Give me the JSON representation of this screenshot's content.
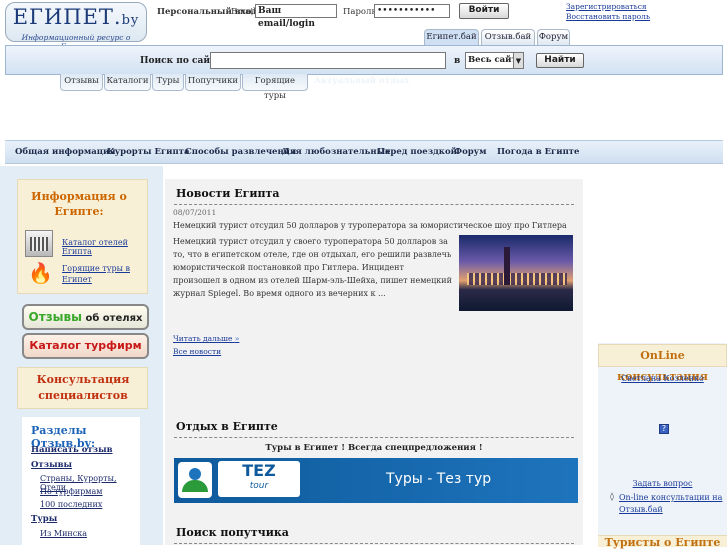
{
  "header": {
    "logo_title": "ЕГИПЕТ.",
    "logo_suffix": "by",
    "logo_subtitle": "Информационный ресурс о Египте",
    "login_label": "Персональный вход:",
    "email_label": "Email:",
    "email_value": "Ваш email/login",
    "password_label": "Пароль:",
    "password_value": "•••••••••••",
    "login_button": "Войти",
    "register_link": "Зарегистрироваться",
    "restore_link": "Восстановить пароль"
  },
  "top_tabs": [
    "Египет.бай",
    "Отзыв.бай",
    "Форум"
  ],
  "search": {
    "label": "Поиск по сайту:",
    "value": "",
    "in_label": "в",
    "scope": "Весь сайт",
    "button": "Найти"
  },
  "sub_tabs": [
    "Отзывы",
    "Каталоги",
    "Туры",
    "Попутчики",
    "Горящие туры"
  ],
  "hidden_tab": "Актуальный отдых",
  "main_nav": [
    "Общая информация",
    "Курорты Египта",
    "Способы развлечения",
    "Для любознательных",
    "Перед поездкой",
    "Форум",
    "Погода в Египте"
  ],
  "left": {
    "info_title": "Информация о Египте:",
    "info_links": [
      "Каталог отелей Египта",
      "Горящие туры в Египет"
    ],
    "promo_reviews_1": "Отзывы",
    "promo_reviews_2": " об отелях",
    "promo_catalog": "Каталог турфирм",
    "consult_title": "Консультация специалистов",
    "sections_title": "Разделы Отзыв.by:",
    "write_review": "Написать отзыв",
    "reviews_heading": "Отзывы",
    "reviews_items": [
      "Страны, Курорты, Отели",
      "По турфирмам",
      "100 последних"
    ],
    "tours_heading": "Туры",
    "tours_items": [
      "Из Минска"
    ]
  },
  "news": {
    "title": "Новости Египта",
    "date": "08/07/2011",
    "headline": "Немецкий турист отсудил 50 долларов у туроператора за юмористическое шоу про Гитлера",
    "body": "Немецкий турист отсудил у своего туроператора 50 долларов за то, что в египетском отеле, где он отдыхал, его решили развлечь юмористической постановкой про Гитлера. Инцидент произошел в одном из отелей Шарм-эль-Шейха, пишет немецкий журнал Spiegel. Во время одного из вечерних к ...",
    "read_more": "Читать дальше",
    "all_news": "Все новости"
  },
  "rest": {
    "title": "Отдых в Египте",
    "subtitle": "Туры в Египет ! Всегда спецпредложения !",
    "banner_logo": "TEZ",
    "banner_logo_sub": "tour",
    "banner_text": "Туры - Тез тур"
  },
  "companion": {
    "title": "Поиск попутчика"
  },
  "right": {
    "online_title": "OnLine консультация",
    "consultant": "Светлана Козленко",
    "status_icon": "?",
    "ask_link": "Задать вопрос",
    "online_link": "On-line консультации на Отзыв.бай",
    "tourists_title": "Туристы о Египте"
  },
  "colors": {
    "accent_orange": "#cc6600",
    "link_blue": "#1a3a9a",
    "nav_bg": "#dce8f5"
  }
}
